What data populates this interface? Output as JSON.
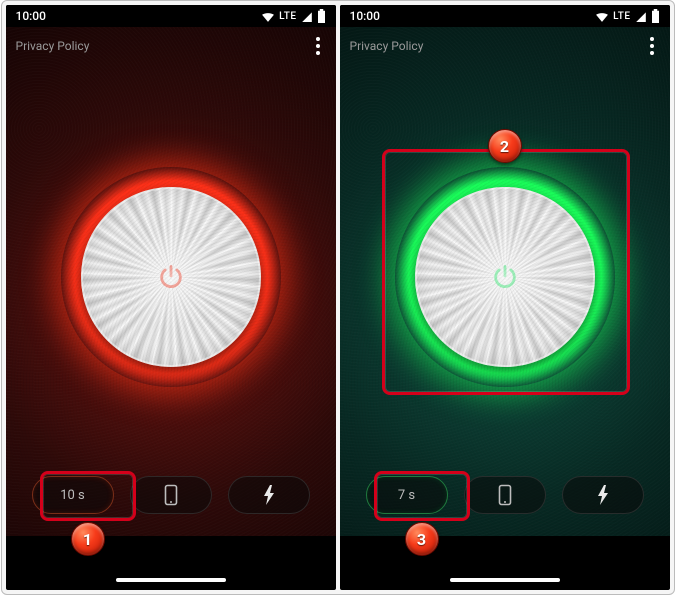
{
  "status": {
    "time": "10:00",
    "network_label": "LTE"
  },
  "header": {
    "privacy_link": "Privacy Policy"
  },
  "screens": [
    {
      "id": "left",
      "theme": "red",
      "accent": "#ff3018",
      "timer_label": "10 s",
      "timer_active": true
    },
    {
      "id": "right",
      "theme": "green",
      "accent": "#19ff5a",
      "timer_label": "7 s",
      "timer_active": true
    }
  ],
  "controls": {
    "phone_icon": "phone-outline-icon",
    "flash_icon": "flash-icon"
  },
  "annotations": {
    "b1": "1",
    "b2": "2",
    "b3": "3"
  }
}
